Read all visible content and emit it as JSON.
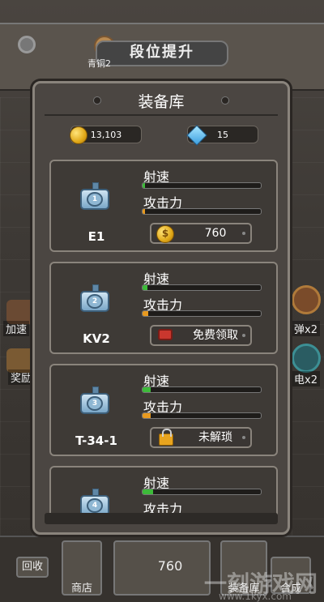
{
  "header": {
    "rank_title": "段位提升",
    "rank_sub": "青铜2"
  },
  "side": {
    "left_1": "加速",
    "left_2": "奖励",
    "right_1": "弹x2",
    "right_2": "电x2"
  },
  "bottom": {
    "recycle": "回收",
    "shop": "商店",
    "coins": "760",
    "armory": "装备库",
    "merge": "合成",
    "watermark": "一刻游戏网",
    "watermark_url": "www.1kyx.com"
  },
  "modal": {
    "title": "装备库",
    "currency": {
      "coins": "13,103",
      "gems": "15"
    },
    "stat_labels": {
      "speed": "射速",
      "attack": "攻击力"
    },
    "items": [
      {
        "name": "E1",
        "level": "1",
        "speed": 0.02,
        "attack": 0.02,
        "action": {
          "type": "buy",
          "icon": "coin-icon",
          "label": "760"
        }
      },
      {
        "name": "KV2",
        "level": "2",
        "speed": 0.04,
        "attack": 0.05,
        "action": {
          "type": "ad",
          "icon": "tv-icon",
          "label": "免费领取"
        }
      },
      {
        "name": "T-34-1",
        "level": "3",
        "speed": 0.07,
        "attack": 0.07,
        "action": {
          "type": "locked",
          "icon": "lock-icon",
          "label": "未解琐"
        }
      },
      {
        "name": "",
        "level": "4",
        "speed": 0.09,
        "attack": 0.1,
        "action": null
      }
    ]
  },
  "colors": {
    "speed_bar": "#3dbb3a",
    "attack_bar": "#e89a20"
  }
}
